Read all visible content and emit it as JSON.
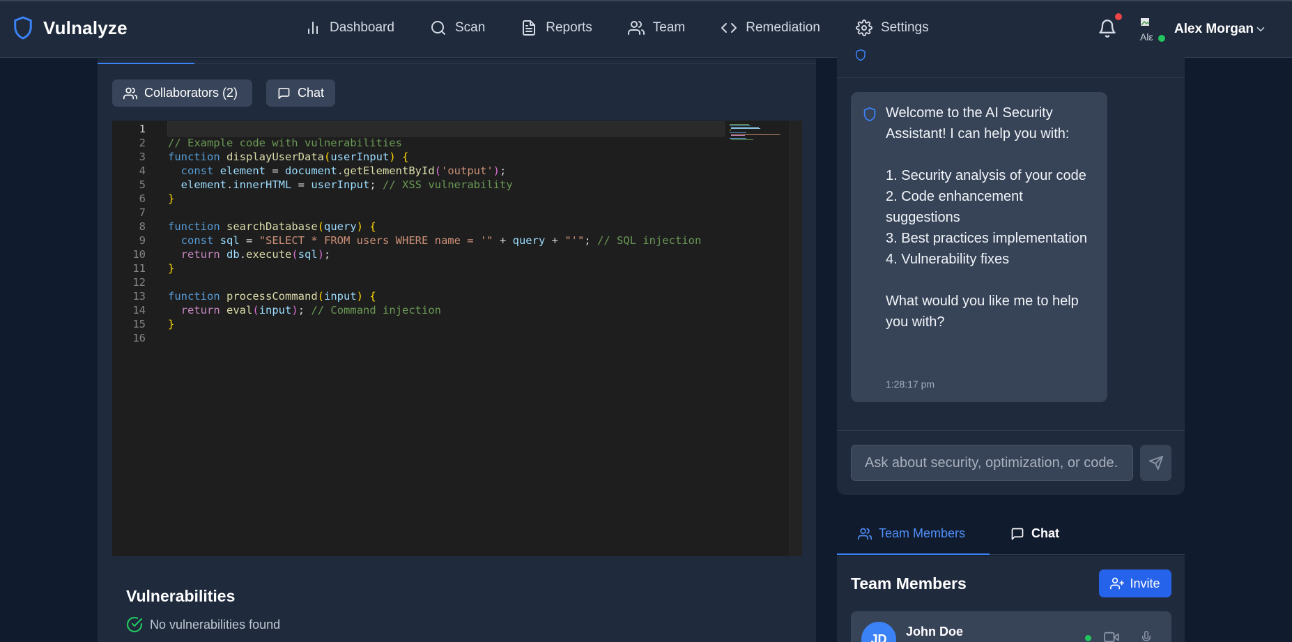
{
  "app": {
    "name": "Vulnalyze"
  },
  "nav": {
    "items": [
      {
        "label": "Dashboard",
        "icon": "bar-chart-icon"
      },
      {
        "label": "Scan",
        "icon": "search-icon"
      },
      {
        "label": "Reports",
        "icon": "file-text-icon"
      },
      {
        "label": "Team",
        "icon": "users-icon"
      },
      {
        "label": "Remediation",
        "icon": "code-icon"
      },
      {
        "label": "Settings",
        "icon": "gear-icon"
      }
    ]
  },
  "user": {
    "name": "Alex Morgan",
    "avatar_alt": "Alex Morgan",
    "has_notification": true,
    "online": true
  },
  "toolbar": {
    "collaborators_label": "Collaborators (2)",
    "chat_label": "Chat"
  },
  "editor": {
    "language": "javascript",
    "active_line": 1,
    "lines": [
      "",
      "// Example code with vulnerabilities",
      "function displayUserData(userInput) {",
      "  const element = document.getElementById('output');",
      "  element.innerHTML = userInput; // XSS vulnerability",
      "}",
      "",
      "function searchDatabase(query) {",
      "  const sql = \"SELECT * FROM users WHERE name = '\" + query + \"'\"; // SQL injection",
      "  return db.execute(sql);",
      "}",
      "",
      "function processCommand(input) {",
      "  return eval(input); // Command injection",
      "}",
      ""
    ]
  },
  "vulnerabilities": {
    "title": "Vulnerabilities",
    "status": "No vulnerabilities found"
  },
  "assistant": {
    "message": "Welcome to the AI Security Assistant! I can help you with:\n\n1. Security analysis of your code\n2. Code enhancement suggestions\n3. Best practices implementation\n4. Vulnerability fixes\n\nWhat would you like me to help you with?",
    "time": "1:28:17 pm",
    "input_placeholder": "Ask about security, optimization, or code..."
  },
  "team": {
    "tabs": [
      {
        "label": "Team Members",
        "active": true
      },
      {
        "label": "Chat",
        "active": false
      }
    ],
    "title": "Team Members",
    "invite_label": "Invite",
    "members": [
      {
        "initials": "JD",
        "name": "John Doe",
        "online": true
      }
    ]
  },
  "colors": {
    "accent": "#3b82f6",
    "online": "#22c55e",
    "notification": "#ef4444"
  }
}
